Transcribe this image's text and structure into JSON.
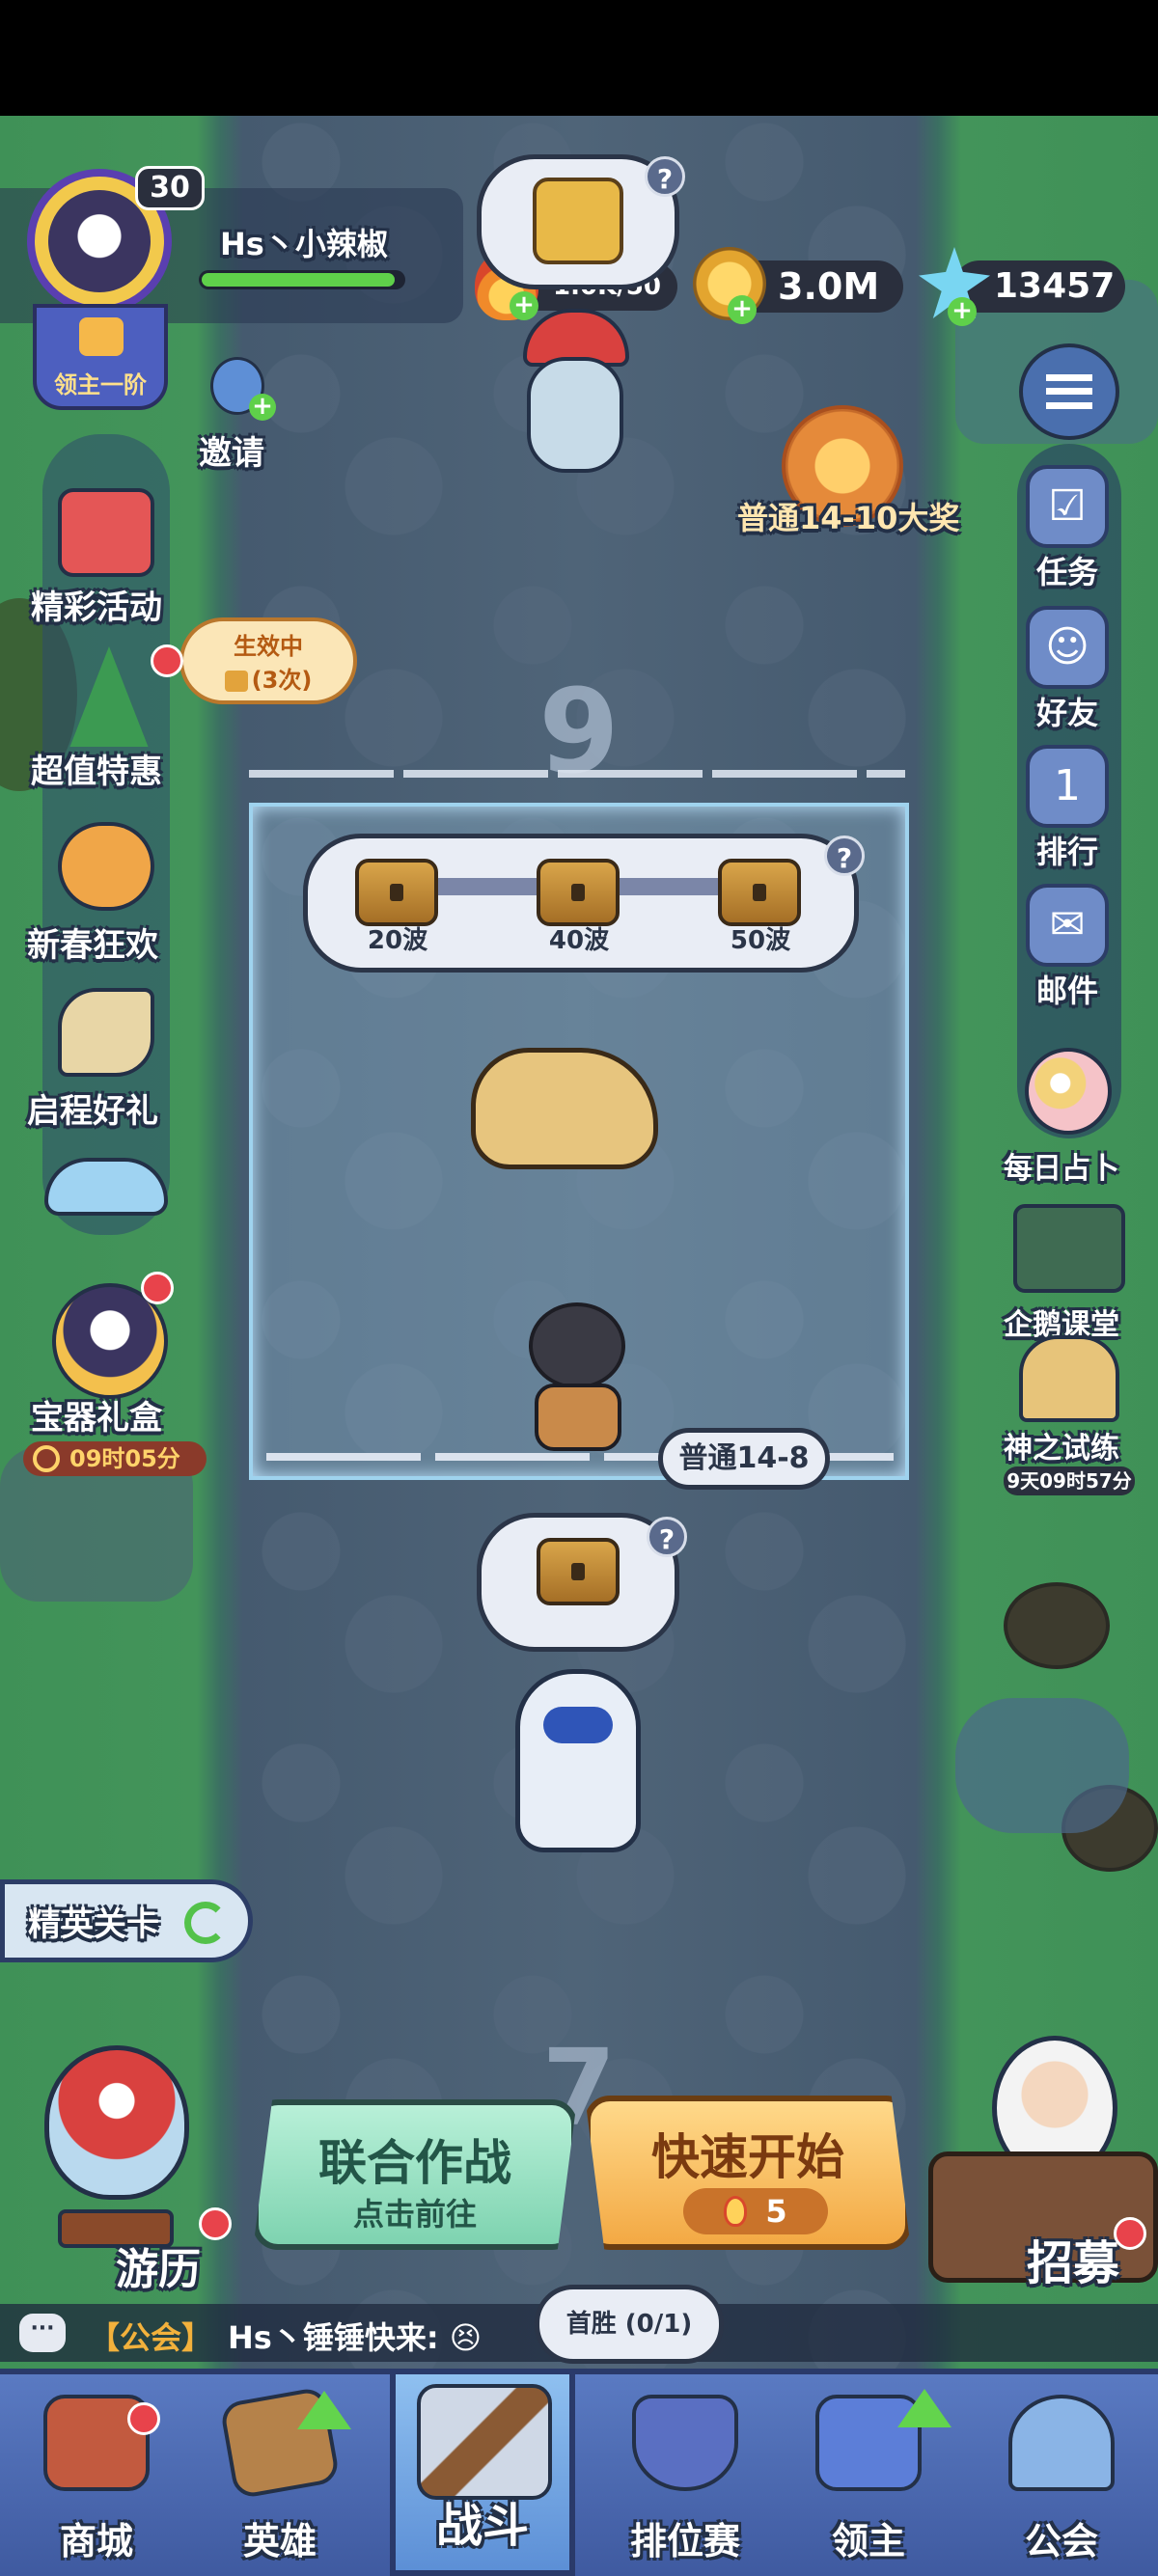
{
  "player": {
    "level": "30",
    "name": "Hs丶小辣椒",
    "rank_badge": "领主一阶",
    "invite_label": "邀请"
  },
  "resources": {
    "stamina": "1.0K/50",
    "gold": "3.0M",
    "gems": "13457"
  },
  "left_menu": [
    {
      "label": "精彩活动",
      "icon": "gift-box-icon"
    },
    {
      "label": "超值特惠",
      "icon": "christmas-tree-icon"
    },
    {
      "label": "新春狂欢",
      "icon": "festival-icon"
    },
    {
      "label": "启程好礼",
      "icon": "pegasus-icon"
    }
  ],
  "buff_badge": {
    "line1": "生效中",
    "line2": "(3次)"
  },
  "treasure_gift": {
    "label": "宝器礼盒",
    "timer": "09时05分"
  },
  "right_menu": [
    {
      "label": "任务",
      "icon": "clipboard-icon"
    },
    {
      "label": "好友",
      "icon": "friends-icon"
    },
    {
      "label": "排行",
      "icon": "podium-icon"
    },
    {
      "label": "邮件",
      "icon": "mail-icon"
    }
  ],
  "right_features": [
    {
      "label": "每日占卜",
      "icon": "crystal-ball-icon"
    },
    {
      "label": "企鹅课堂",
      "icon": "penguin-teacher-icon"
    },
    {
      "label": "神之试练",
      "icon": "temple-icon",
      "timer": "9天09时57分"
    }
  ],
  "grand_prize_label": "普通14-10大奖",
  "stage": {
    "current_number": "9",
    "next_number": "7",
    "current_label": "普通14-8",
    "wave_rewards": [
      "20波",
      "40波",
      "50波"
    ]
  },
  "elite_stage_label": "精英关卡",
  "journey_label": "游历",
  "recruit_label": "招募",
  "buttons": {
    "coop_title": "联合作战",
    "coop_sub": "点击前往",
    "quick_title": "快速开始",
    "quick_cost": "5"
  },
  "first_win": "首胜 (0/1)",
  "chat": {
    "channel": "【公会】",
    "text": "Hs丶锤锤快来: 😣"
  },
  "bottom_nav": [
    "商城",
    "英雄",
    "战斗",
    "排位赛",
    "领主",
    "公会"
  ]
}
